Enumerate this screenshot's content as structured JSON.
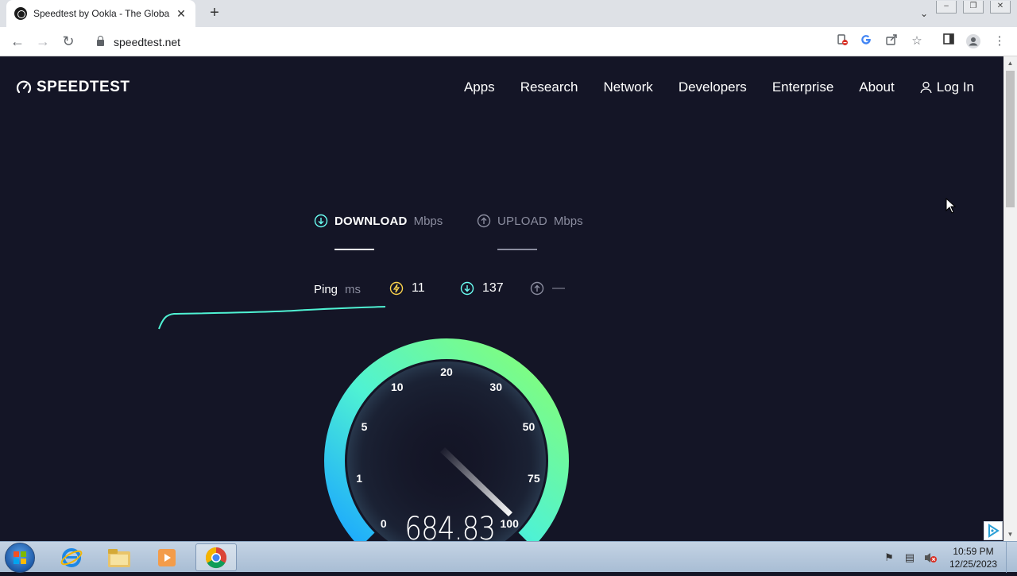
{
  "browser": {
    "tab_title": "Speedtest by Ookla - The Global",
    "tab_close": "✕",
    "new_tab": "+",
    "url": "speedtest.net"
  },
  "header": {
    "logo_text": "SPEEDTEST",
    "nav": [
      "Apps",
      "Research",
      "Network",
      "Developers",
      "Enterprise",
      "About"
    ],
    "login": "Log In"
  },
  "test_tabs": {
    "download": {
      "label": "DOWNLOAD",
      "unit": "Mbps",
      "color": "#6afff3"
    },
    "upload": {
      "label": "UPLOAD",
      "unit": "Mbps",
      "color": "#8b8d9f"
    }
  },
  "ping": {
    "label": "Ping",
    "unit": "ms",
    "ping_value": "11",
    "download_value": "137",
    "upload_value": "—"
  },
  "gauge": {
    "ticks": [
      "0",
      "1",
      "5",
      "10",
      "20",
      "30",
      "50",
      "75",
      "100"
    ],
    "speed": "684.83",
    "colors": {
      "start": "#1aa6ff",
      "mid": "#4ff2d3",
      "end": "#8aff6e"
    }
  },
  "taskbar": {
    "time": "10:59 PM",
    "date": "12/25/2023"
  }
}
